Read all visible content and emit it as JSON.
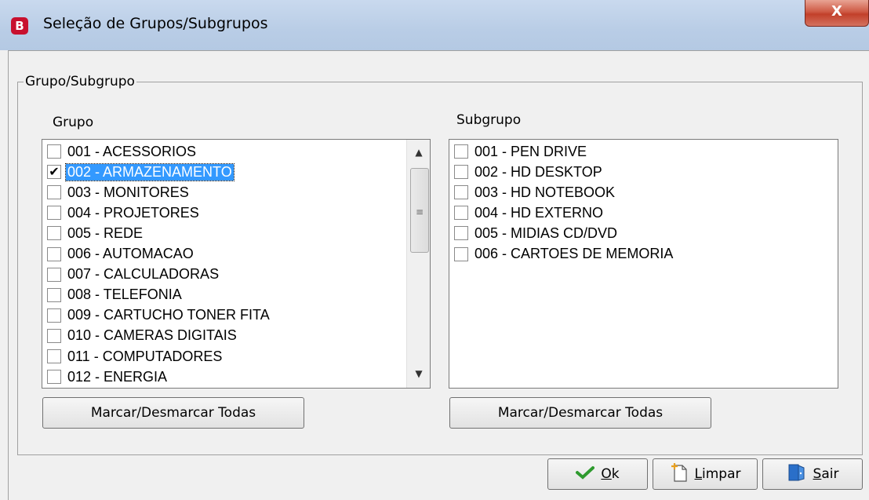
{
  "window": {
    "app_icon_letter": "B",
    "title": "Seleção de Grupos/Subgrupos",
    "close_label": "X"
  },
  "groupbox": {
    "label": "Grupo/Subgrupo"
  },
  "grupo": {
    "label": "Grupo",
    "items": [
      {
        "label": "001 - ACESSORIOS",
        "checked": false,
        "selected": false
      },
      {
        "label": "002 - ARMAZENAMENTO",
        "checked": true,
        "selected": true
      },
      {
        "label": "003 - MONITORES",
        "checked": false,
        "selected": false
      },
      {
        "label": "004 - PROJETORES",
        "checked": false,
        "selected": false
      },
      {
        "label": "005 - REDE",
        "checked": false,
        "selected": false
      },
      {
        "label": "006 - AUTOMACAO",
        "checked": false,
        "selected": false
      },
      {
        "label": "007 - CALCULADORAS",
        "checked": false,
        "selected": false
      },
      {
        "label": "008 - TELEFONIA",
        "checked": false,
        "selected": false
      },
      {
        "label": "009 - CARTUCHO TONER FITA",
        "checked": false,
        "selected": false
      },
      {
        "label": "010 - CAMERAS DIGITAIS",
        "checked": false,
        "selected": false
      },
      {
        "label": "011 - COMPUTADORES",
        "checked": false,
        "selected": false
      },
      {
        "label": "012 - ENERGIA",
        "checked": false,
        "selected": false
      }
    ],
    "toggle_all_label": "Marcar/Desmarcar Todas"
  },
  "subgrupo": {
    "label": "Subgrupo",
    "items": [
      {
        "label": "001 - PEN DRIVE",
        "checked": false
      },
      {
        "label": "002 - HD DESKTOP",
        "checked": false
      },
      {
        "label": "003 - HD NOTEBOOK",
        "checked": false
      },
      {
        "label": "004 - HD EXTERNO",
        "checked": false
      },
      {
        "label": "005 - MIDIAS CD/DVD",
        "checked": false
      },
      {
        "label": "006 - CARTOES DE MEMORIA",
        "checked": false
      }
    ],
    "toggle_all_label": "Marcar/Desmarcar Todas"
  },
  "actions": {
    "ok": {
      "mnemonic": "O",
      "rest": "k",
      "icon": "checkmark-icon"
    },
    "limpar": {
      "mnemonic": "L",
      "rest": "impar",
      "icon": "new-document-icon"
    },
    "sair": {
      "mnemonic": "S",
      "rest": "air",
      "icon": "exit-door-icon"
    }
  },
  "colors": {
    "selection": "#3399ff",
    "ok_check": "#2e9a2e",
    "close": "#c2402a"
  }
}
